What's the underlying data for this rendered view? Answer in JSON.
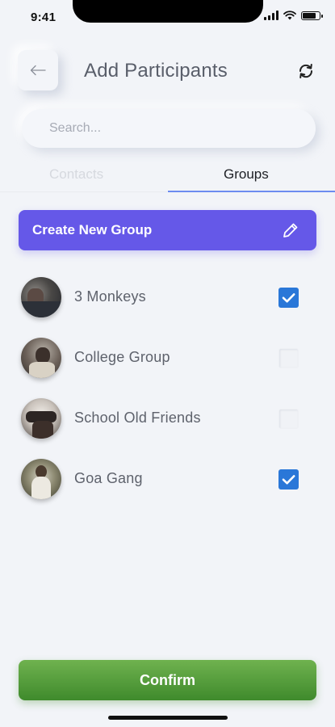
{
  "status_bar": {
    "time": "9:41",
    "battery_level": 0.85
  },
  "header": {
    "title": "Add Participants",
    "back_icon": "arrow-left-icon",
    "refresh_icon": "refresh-icon"
  },
  "search": {
    "placeholder": "Search..."
  },
  "tabs": [
    {
      "label": "Contacts",
      "active": false
    },
    {
      "label": "Groups",
      "active": true
    }
  ],
  "create_group": {
    "label": "Create New Group",
    "icon": "pencil-icon"
  },
  "groups": [
    {
      "name": "3 Monkeys",
      "checked": true
    },
    {
      "name": "College Group",
      "checked": false
    },
    {
      "name": "School Old Friends",
      "checked": false
    },
    {
      "name": "Goa Gang",
      "checked": true
    }
  ],
  "confirm": {
    "label": "Confirm"
  },
  "colors": {
    "accent": "#6558e8",
    "checkbox": "#2a77d8",
    "confirm": "#4f9c38",
    "tab_indicator": "#6d8cf0"
  }
}
